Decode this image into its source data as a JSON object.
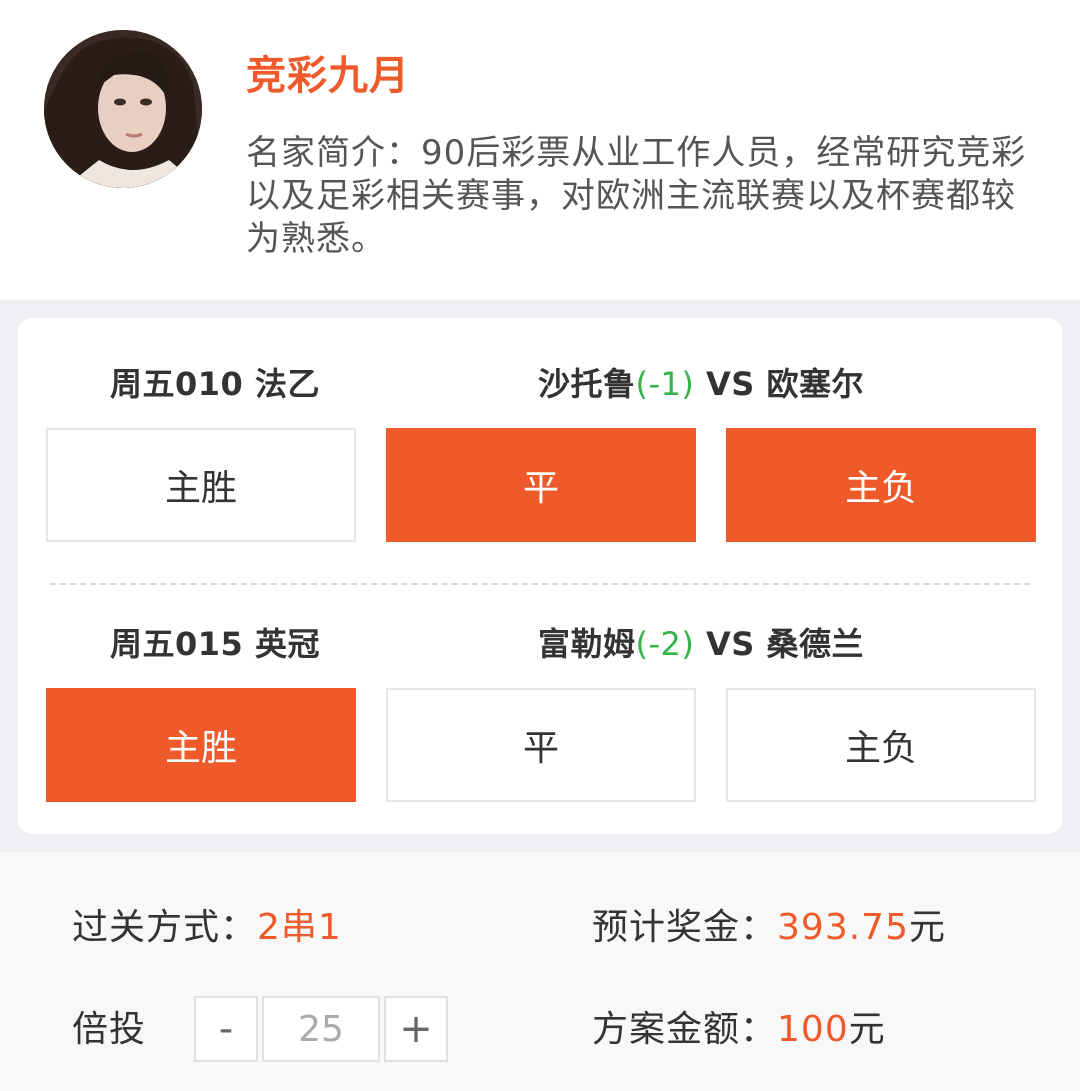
{
  "expert": {
    "name": "竞彩九月",
    "intro": "名家简介：90后彩票从业工作人员，经常研究竞彩以及足彩相关赛事，对欧洲主流联赛以及杯赛都较为熟悉。"
  },
  "matches": [
    {
      "info": "周五010 法乙",
      "home": "沙托鲁",
      "handicap": "(-1)",
      "vs": " VS ",
      "away": "欧塞尔",
      "options": [
        {
          "label": "主胜",
          "selected": false
        },
        {
          "label": "平",
          "selected": true
        },
        {
          "label": "主负",
          "selected": true
        }
      ]
    },
    {
      "info": "周五015 英冠",
      "home": "富勒姆",
      "handicap": "(-2)",
      "vs": " VS ",
      "away": "桑德兰",
      "options": [
        {
          "label": "主胜",
          "selected": true
        },
        {
          "label": "平",
          "selected": false
        },
        {
          "label": "主负",
          "selected": false
        }
      ]
    }
  ],
  "summary": {
    "pass_mode_label": "过关方式：",
    "pass_mode_value": "2串1",
    "prize_label": "预计奖金：",
    "prize_value": "393.75",
    "prize_unit": "元",
    "multiple_label": "倍投",
    "minus": "-",
    "multiple_value": "25",
    "plus": "+",
    "amount_label": "方案金额：",
    "amount_value": "100",
    "amount_unit": "元"
  },
  "colors": {
    "accent": "#ef5a2b",
    "handicap": "#35b34a",
    "panel_bg": "#efeff4"
  }
}
